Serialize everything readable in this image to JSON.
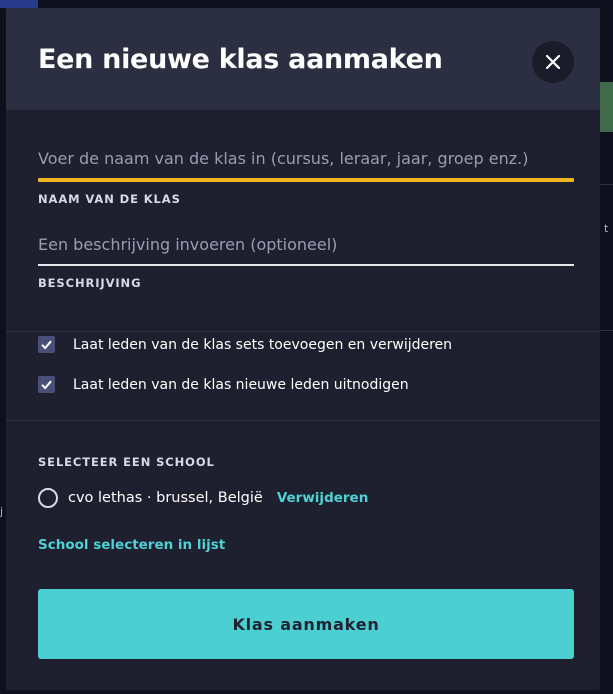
{
  "dialog": {
    "title": "Een nieuwe klas aanmaken",
    "close_icon": "close-icon"
  },
  "class_name": {
    "value": "",
    "placeholder": "Voer de naam van de klas in (cursus, leraar, jaar, groep enz.)",
    "label": "NAAM VAN DE KLAS"
  },
  "description": {
    "value": "",
    "placeholder": "Een beschrijving invoeren (optioneel)",
    "label": "BESCHRIJVING"
  },
  "permissions": [
    {
      "label": "Laat leden van de klas sets toevoegen en verwijderen",
      "checked": true
    },
    {
      "label": "Laat leden van de klas nieuwe leden uitnodigen",
      "checked": true
    }
  ],
  "school": {
    "section_label": "SELECTEER EEN SCHOOL",
    "selected_school": "cvo lethas · brussel, België",
    "selected": false,
    "remove_label": "Verwijderen",
    "select_from_list_label": "School selecteren in lijst"
  },
  "submit": {
    "label": "Klas aanmaken"
  },
  "background": {
    "left_letter": "j"
  },
  "colors": {
    "accent": "#4ccfd0",
    "focus_underline": "#f0b51e",
    "modal_bg": "#1e2030",
    "header_bg": "#2c2f41",
    "checkbox": "#4a4f7a"
  }
}
